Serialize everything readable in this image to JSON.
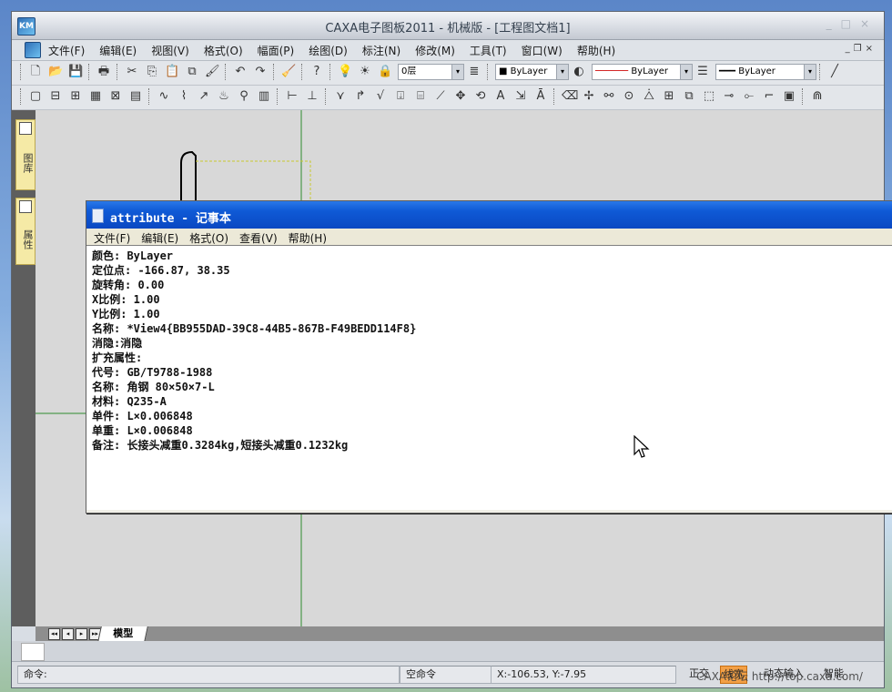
{
  "window": {
    "title": "CAXA电子图板2011 - 机械版 - [工程图文档1]"
  },
  "app_logo_text": "KM",
  "menu": [
    "文件(F)",
    "编辑(E)",
    "视图(V)",
    "格式(O)",
    "幅面(P)",
    "绘图(D)",
    "标注(N)",
    "修改(M)",
    "工具(T)",
    "窗口(W)",
    "帮助(H)"
  ],
  "toolbar": {
    "layer": "0层",
    "color_layer": "ByLayer",
    "linetype_layer": "ByLayer",
    "lineweight_layer": "ByLayer"
  },
  "left_panel": {
    "tab1": "图库",
    "tab2": "属性"
  },
  "model_tab": "模型",
  "status": {
    "command": "命令:",
    "empty_command": "空命令",
    "coords": "X:-106.53, Y:-7.95",
    "ortho": "正交",
    "linewidth": "线宽",
    "dynamic_input": "动态输入",
    "snap": "智能",
    "watermark": "CAXA论坛 http://top.caxa.com/"
  },
  "notepad": {
    "title": "attribute - 记事本",
    "menu": [
      "文件(F)",
      "编辑(E)",
      "格式(O)",
      "查看(V)",
      "帮助(H)"
    ],
    "lines": [
      "颜色: ByLayer",
      "定位点: -166.87, 38.35",
      "旋转角: 0.00",
      "X比例: 1.00",
      "Y比例: 1.00",
      "名称: *View4{BB955DAD-39C8-44B5-867B-F49BEDD114F8}",
      "消隐:消隐",
      "扩充属性:",
      "代号: GB/T9788-1988",
      "名称: 角钢 80×50×7-L",
      "材料: Q235-A",
      "单件: L×0.006848",
      "单重: L×0.006848",
      "备注: 长接头减重0.3284kg,短接头减重0.1232kg"
    ]
  }
}
